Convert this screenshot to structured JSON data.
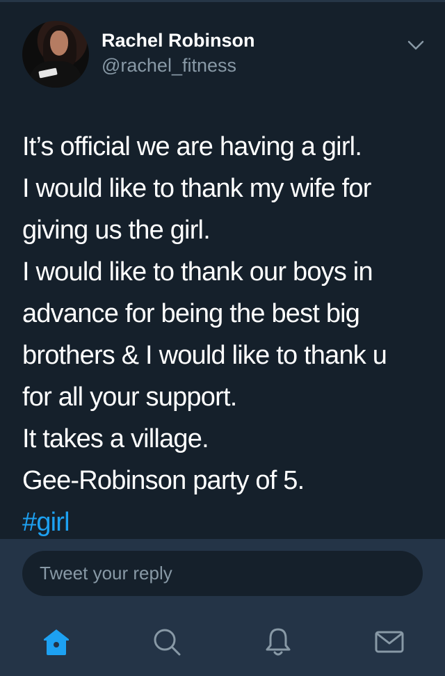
{
  "tweet": {
    "author_name": "Rachel Robinson",
    "author_handle": "@rachel_fitness",
    "lines": [
      "It’s official we are having a girl.",
      "I would like to thank my wife for",
      "giving us the girl.",
      "I would like to thank our boys in",
      "advance for being the best big",
      "brothers & I would like to thank u",
      "for all your support.",
      "It takes a village.",
      "Gee-Robinson party of 5."
    ],
    "hashtag": "#girl"
  },
  "reply": {
    "placeholder": "Tweet your reply"
  },
  "icons": {
    "more": "chevron-down-icon",
    "avatar": "avatar",
    "home": "home-icon",
    "search": "search-icon",
    "notifications": "bell-icon",
    "messages": "mail-icon"
  },
  "colors": {
    "background": "#15202b",
    "bar_background": "#243447",
    "accent": "#1da1f2",
    "secondary_text": "#8899a6"
  }
}
